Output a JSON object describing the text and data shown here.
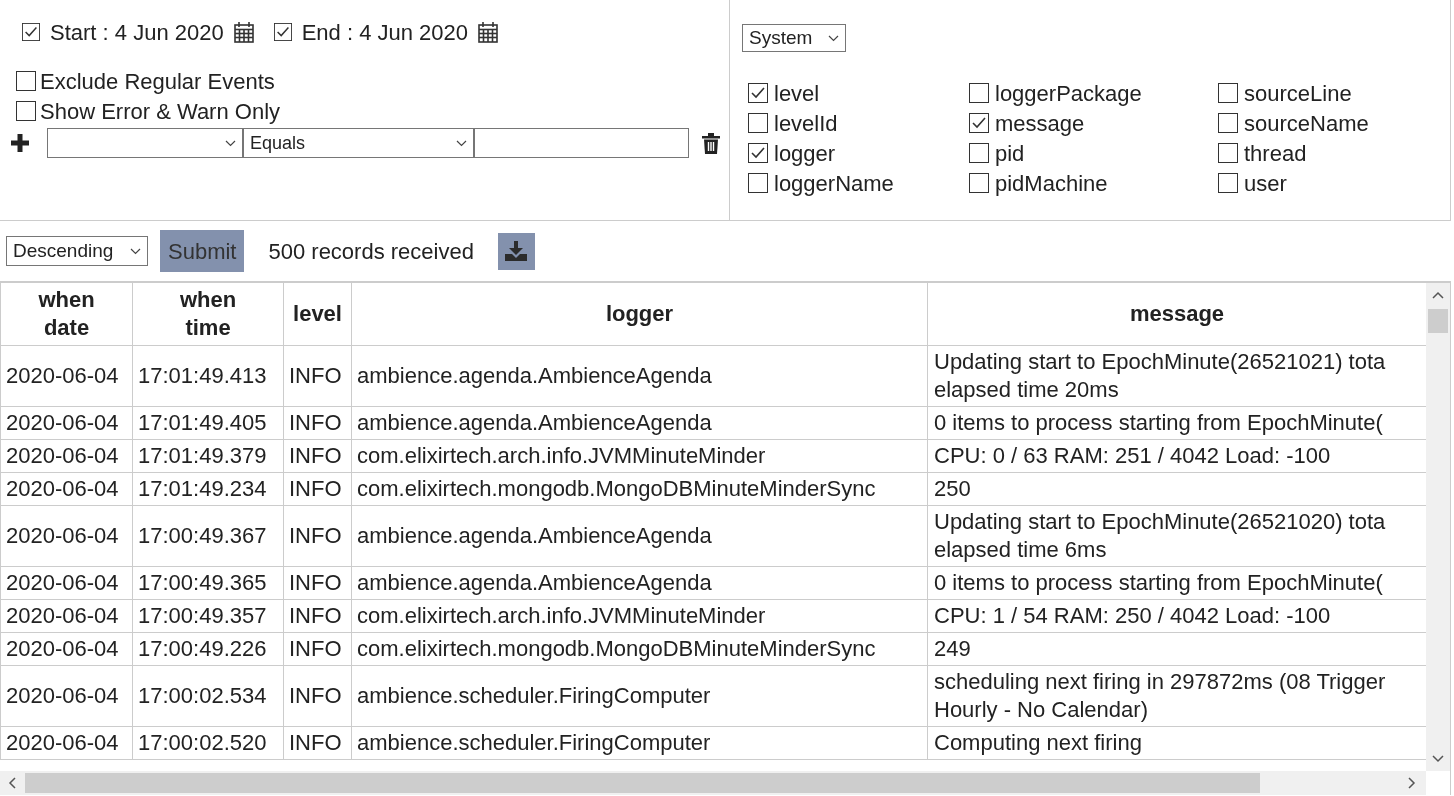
{
  "date_range": [
    {
      "label": "Start : 4 Jun 2020",
      "checked": true
    },
    {
      "label": "End : 4 Jun 2020",
      "checked": true
    }
  ],
  "options": [
    {
      "label": "Exclude Regular Events",
      "checked": false
    },
    {
      "label": "Show Error & Warn Only",
      "checked": false
    }
  ],
  "filter": {
    "operator": "Equals"
  },
  "category_select": "System",
  "field_columns": [
    [
      {
        "label": "level",
        "checked": true
      },
      {
        "label": "levelId",
        "checked": false
      },
      {
        "label": "logger",
        "checked": true
      },
      {
        "label": "loggerName",
        "checked": false
      }
    ],
    [
      {
        "label": "loggerPackage",
        "checked": false
      },
      {
        "label": "message",
        "checked": true
      },
      {
        "label": "pid",
        "checked": false
      },
      {
        "label": "pidMachine",
        "checked": false
      }
    ],
    [
      {
        "label": "sourceLine",
        "checked": false
      },
      {
        "label": "sourceName",
        "checked": false
      },
      {
        "label": "thread",
        "checked": false
      },
      {
        "label": "user",
        "checked": false
      }
    ]
  ],
  "toolbar": {
    "sort": "Descending",
    "submit": "Submit",
    "record_count": "500 records received"
  },
  "table": {
    "columns": [
      [
        "when",
        "date"
      ],
      [
        "when",
        "time"
      ],
      [
        "level"
      ],
      [
        "logger"
      ],
      [
        "message"
      ]
    ],
    "rows": [
      {
        "date": "2020-06-04",
        "time": "17:01:49.413",
        "level": "INFO",
        "logger": "ambience.agenda.AmbienceAgenda",
        "message": [
          "Updating start to EpochMinute(26521021) tota",
          "elapsed time 20ms"
        ]
      },
      {
        "date": "2020-06-04",
        "time": "17:01:49.405",
        "level": "INFO",
        "logger": "ambience.agenda.AmbienceAgenda",
        "message": [
          "0 items to process starting from EpochMinute("
        ]
      },
      {
        "date": "2020-06-04",
        "time": "17:01:49.379",
        "level": "INFO",
        "logger": "com.elixirtech.arch.info.JVMMinuteMinder",
        "message": [
          "CPU: 0 / 63 RAM: 251 / 4042 Load: -100"
        ]
      },
      {
        "date": "2020-06-04",
        "time": "17:01:49.234",
        "level": "INFO",
        "logger": "com.elixirtech.mongodb.MongoDBMinuteMinderSync",
        "message": [
          "250"
        ]
      },
      {
        "date": "2020-06-04",
        "time": "17:00:49.367",
        "level": "INFO",
        "logger": "ambience.agenda.AmbienceAgenda",
        "message": [
          "Updating start to EpochMinute(26521020) tota",
          "elapsed time 6ms"
        ]
      },
      {
        "date": "2020-06-04",
        "time": "17:00:49.365",
        "level": "INFO",
        "logger": "ambience.agenda.AmbienceAgenda",
        "message": [
          "0 items to process starting from EpochMinute("
        ]
      },
      {
        "date": "2020-06-04",
        "time": "17:00:49.357",
        "level": "INFO",
        "logger": "com.elixirtech.arch.info.JVMMinuteMinder",
        "message": [
          "CPU: 1 / 54 RAM: 250 / 4042 Load: -100"
        ]
      },
      {
        "date": "2020-06-04",
        "time": "17:00:49.226",
        "level": "INFO",
        "logger": "com.elixirtech.mongodb.MongoDBMinuteMinderSync",
        "message": [
          "249"
        ]
      },
      {
        "date": "2020-06-04",
        "time": "17:00:02.534",
        "level": "INFO",
        "logger": "ambience.scheduler.FiringComputer",
        "message": [
          "scheduling next firing in 297872ms (08 Trigger",
          "Hourly - No Calendar)"
        ]
      },
      {
        "date": "2020-06-04",
        "time": "17:00:02.520",
        "level": "INFO",
        "logger": "ambience.scheduler.FiringComputer",
        "message": [
          "Computing next firing"
        ]
      }
    ]
  }
}
